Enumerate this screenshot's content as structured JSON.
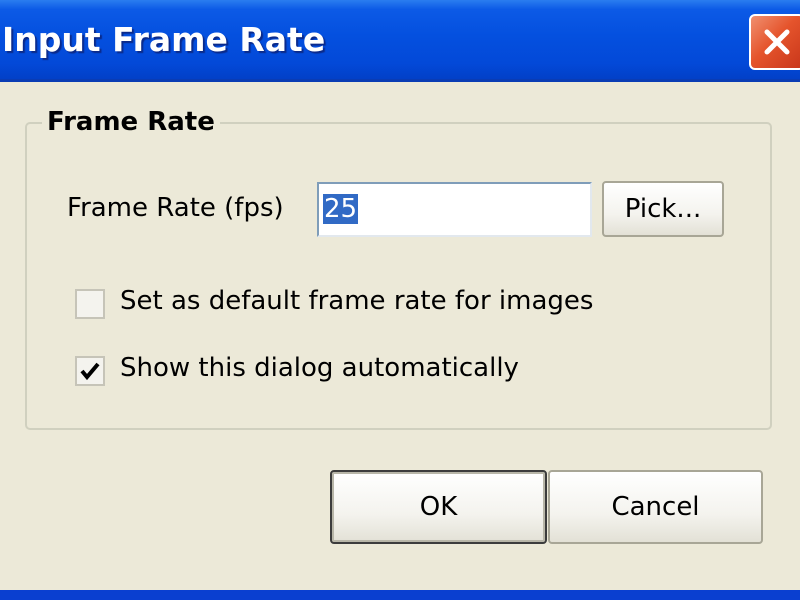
{
  "window": {
    "title": "Input Frame Rate"
  },
  "group": {
    "legend": "Frame Rate"
  },
  "fps": {
    "label": "Frame Rate (fps)",
    "value": "25",
    "pick_label": "Pick..."
  },
  "options": [
    {
      "label": "Set as default frame rate for images",
      "checked": false
    },
    {
      "label": "Show this dialog automatically",
      "checked": true
    }
  ],
  "actions": {
    "ok_label": "OK",
    "cancel_label": "Cancel"
  },
  "colors": {
    "titlebar": "#0450df",
    "dialog_bg": "#ece9d8",
    "selection": "#316ac5",
    "close_button": "#e5542c"
  },
  "icons": {
    "close": "close-icon",
    "check": "checkmark-icon"
  }
}
